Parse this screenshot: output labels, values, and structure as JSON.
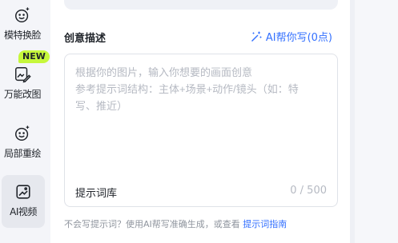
{
  "sidebar": {
    "items": [
      {
        "label": "模特换脸",
        "icon": "smile-sparkle-icon"
      },
      {
        "label": "万能改图",
        "icon": "edit-image-icon",
        "badge": "NEW"
      },
      {
        "label": "局部重绘",
        "icon": "smile-sparkle-icon"
      },
      {
        "label": "AI视频",
        "icon": "video-image-icon",
        "active": true
      }
    ]
  },
  "main": {
    "section_title": "创意描述",
    "ai_write": {
      "label": "AI帮你写",
      "cost": "(0点)",
      "icon": "magic-wand-icon"
    },
    "textbox": {
      "placeholder": "根据你的图片，输入你想要的画面创意\n参考提示词结构：主体+场景+动作/镜头（如：特写、推近）",
      "placeholder_line1": "根据你的图片，输入你想要的画面创意",
      "placeholder_line2": "参考提示词结构：主体+场景+动作/镜头（如：特",
      "placeholder_line3": "写、推近）",
      "prompt_library_label": "提示词库",
      "counter": "0 / 500"
    },
    "hint": {
      "text": "不会写提示词？使用AI帮写准确生成，或查看",
      "link": "提示词指南"
    }
  },
  "colors": {
    "accent": "#3370ff",
    "badge": "#c6f73c",
    "placeholder": "#b5b9c2"
  }
}
